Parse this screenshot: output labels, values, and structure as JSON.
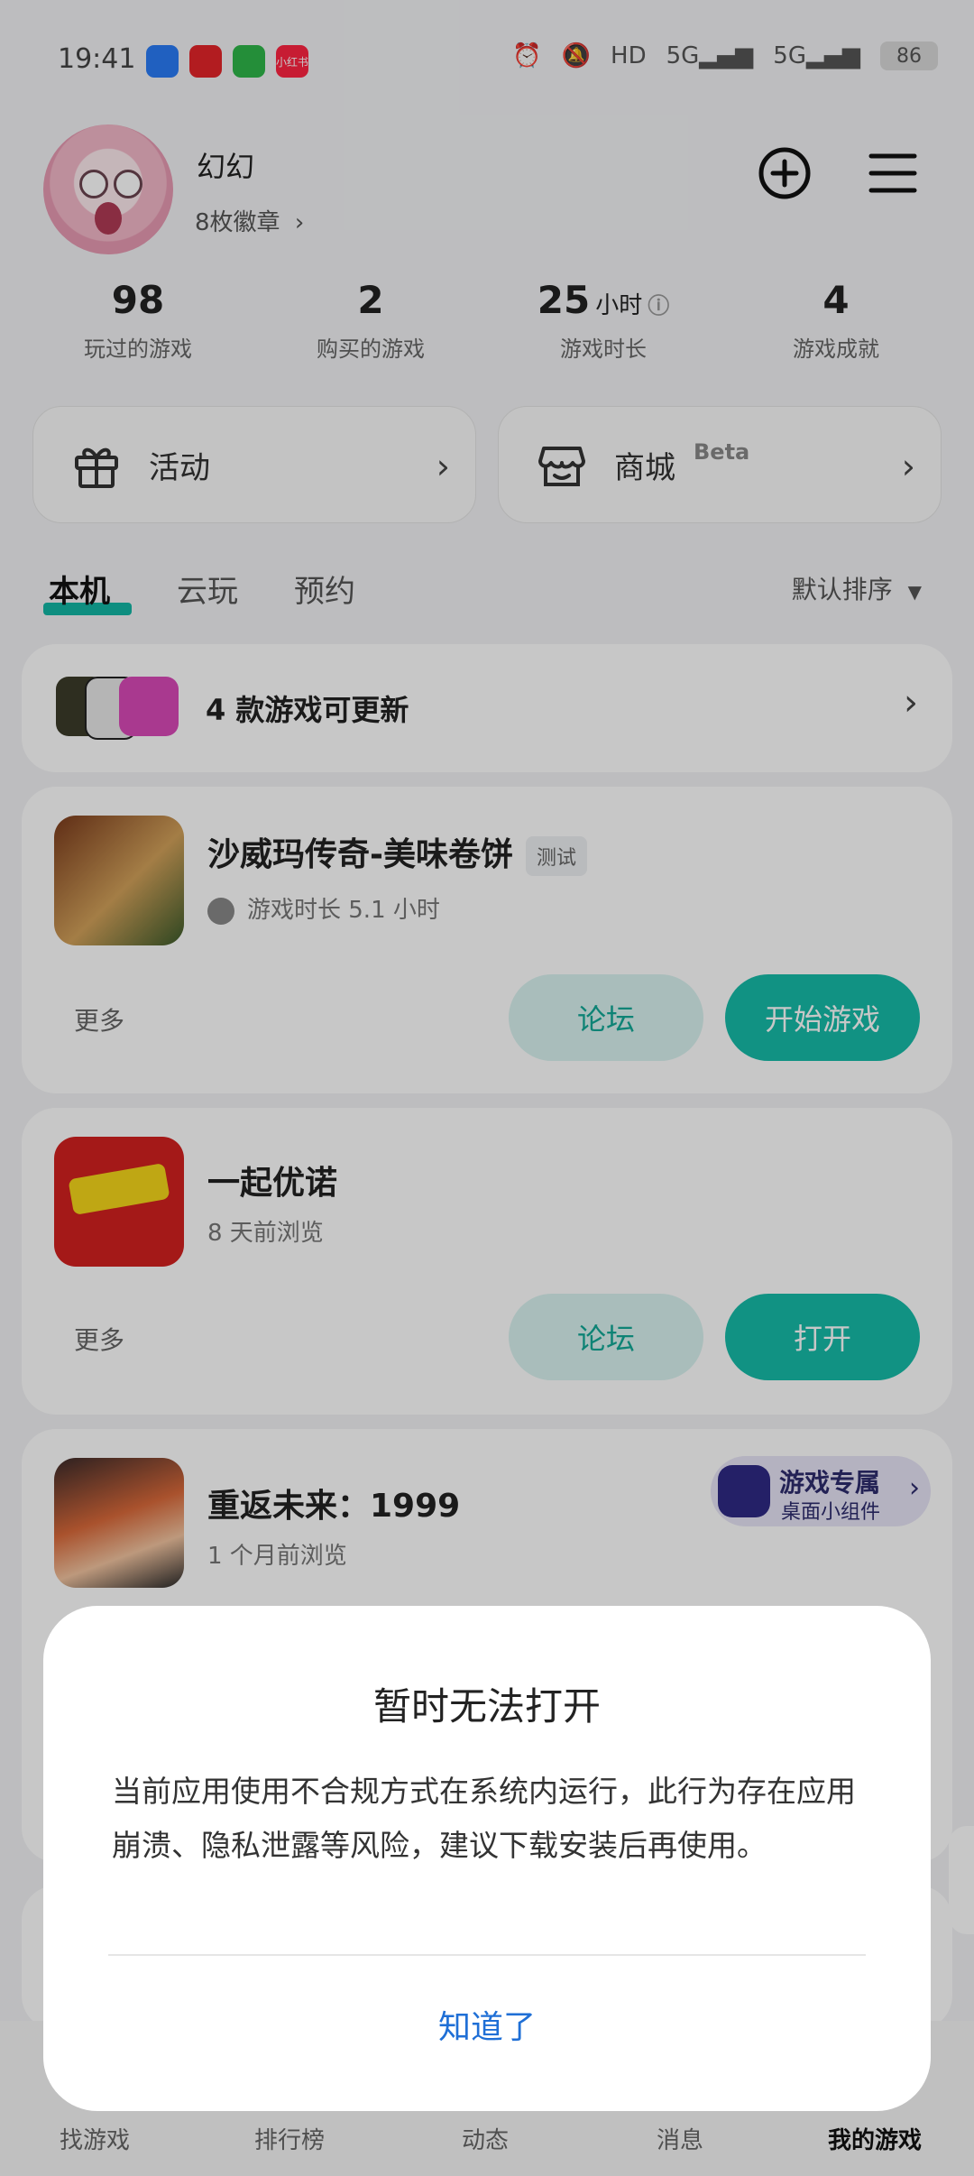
{
  "status_bar": {
    "time": "19:41",
    "battery": "86",
    "signal_labels": [
      "HD",
      "5G",
      "5G"
    ],
    "app_icons": [
      {
        "name": "feishu-icon",
        "color": "#2a7bf6"
      },
      {
        "name": "pinduoduo-icon",
        "color": "#e5252a"
      },
      {
        "name": "messages-icon",
        "color": "#2fb64a"
      },
      {
        "name": "xiaohongshu-icon",
        "color": "#ff2442",
        "text": "小红书"
      }
    ]
  },
  "profile": {
    "username": "幻幻",
    "badges": "8枚徽章",
    "add_icon": "plus-circle-icon",
    "menu_icon": "menu-icon"
  },
  "stats": [
    {
      "value": "98",
      "unit": "",
      "label": "玩过的游戏"
    },
    {
      "value": "2",
      "unit": "",
      "label": "购买的游戏"
    },
    {
      "value": "25",
      "unit": "小时",
      "label": "游戏时长"
    },
    {
      "value": "4",
      "unit": "",
      "label": "游戏成就"
    }
  ],
  "entries": {
    "activity": "活动",
    "store": "商城",
    "store_badge": "Beta"
  },
  "tabs": {
    "items": [
      "本机",
      "云玩",
      "预约"
    ],
    "active": "本机",
    "sort": "默认排序"
  },
  "update_card": {
    "text": "4 款游戏可更新"
  },
  "games": [
    {
      "title": "沙威玛传奇-美味卷饼",
      "tag": "测试",
      "sub": "游戏时长 5.1 小时",
      "more": "更多",
      "forum": "论坛",
      "primary": "开始游戏"
    },
    {
      "title": "一起优诺",
      "sub": "8 天前浏览",
      "more": "更多",
      "forum": "论坛",
      "primary": "打开"
    },
    {
      "title": "重返未来：1999",
      "sub": "1 个月前浏览",
      "widget_title": "游戏专属",
      "widget_sub": "桌面小组件"
    }
  ],
  "dialog": {
    "title": "暂时无法打开",
    "message": "当前应用使用不合规方式在系统内运行，此行为存在应用崩溃、隐私泄露等风险，建议下载安装后再使用。",
    "confirm": "知道了"
  },
  "bottom_nav": {
    "items": [
      "找游戏",
      "排行榜",
      "动态",
      "消息",
      "我的游戏"
    ],
    "active": "我的游戏"
  },
  "colors": {
    "accent": "#16bba8",
    "accent_light": "#d9f3f0",
    "link": "#1f6fd6"
  }
}
